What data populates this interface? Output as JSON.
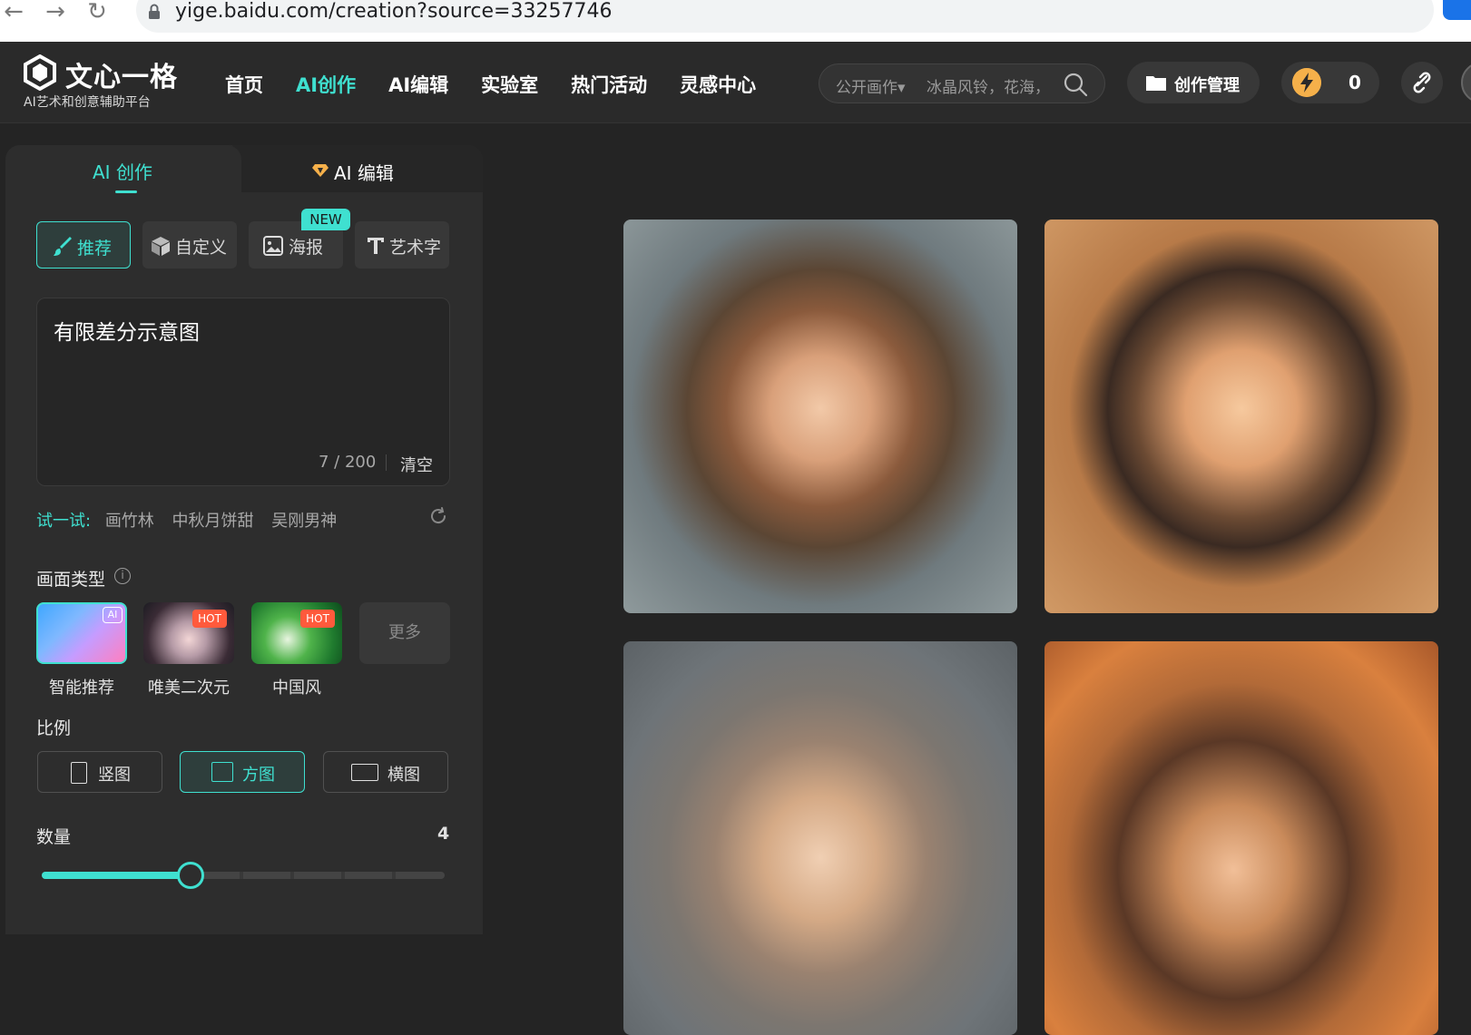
{
  "browser": {
    "url": "yige.baidu.com/creation?source=33257746"
  },
  "header": {
    "logo_title": "文心一格",
    "logo_subtitle": "AI艺术和创意辅助平台",
    "nav": [
      {
        "label": "首页"
      },
      {
        "label": "AI创作"
      },
      {
        "label": "AI编辑"
      },
      {
        "label": "实验室"
      },
      {
        "label": "热门活动"
      },
      {
        "label": "灵感中心"
      }
    ],
    "active_nav": "AI创作",
    "search": {
      "scope": "公开画作▾",
      "placeholder": "冰晶风铃，花海，"
    },
    "manage_label": "创作管理",
    "energy_count": "0"
  },
  "panel": {
    "tabs": [
      {
        "label": "AI 创作"
      },
      {
        "label": "AI 编辑"
      }
    ],
    "modes": [
      {
        "label": "推荐"
      },
      {
        "label": "自定义"
      },
      {
        "label": "海报"
      },
      {
        "label": "艺术字"
      }
    ],
    "new_badge": "NEW",
    "prompt": {
      "text": "有限差分示意图",
      "count": "7 / 200",
      "clear_label": "清空"
    },
    "try": {
      "label": "试一试:",
      "suggestions": [
        "画竹林",
        "中秋月饼甜",
        "吴刚男神"
      ]
    },
    "style_section_title": "画面类型",
    "styles": [
      {
        "label": "智能推荐",
        "badge": "AI"
      },
      {
        "label": "唯美二次元",
        "badge": "HOT"
      },
      {
        "label": "中国风",
        "badge": "HOT"
      }
    ],
    "more_label": "更多",
    "ratio_section_title": "比例",
    "ratios": [
      {
        "label": "竖图"
      },
      {
        "label": "方图"
      },
      {
        "label": "横图"
      }
    ],
    "quantity_section_title": "数量",
    "quantity_value": "4",
    "quantity_fraction": 0.37
  },
  "colors": {
    "accent": "#3fe0d0",
    "hot": "#ff5a3c"
  }
}
